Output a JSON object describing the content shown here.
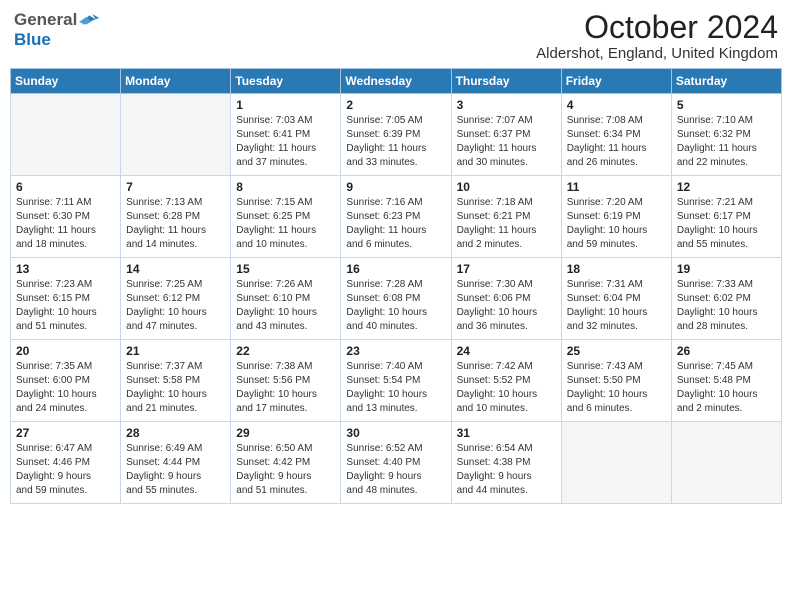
{
  "header": {
    "logo_general": "General",
    "logo_blue": "Blue",
    "month_title": "October 2024",
    "location": "Aldershot, England, United Kingdom"
  },
  "weekdays": [
    "Sunday",
    "Monday",
    "Tuesday",
    "Wednesday",
    "Thursday",
    "Friday",
    "Saturday"
  ],
  "weeks": [
    [
      {
        "day": "",
        "info": ""
      },
      {
        "day": "",
        "info": ""
      },
      {
        "day": "1",
        "info": "Sunrise: 7:03 AM\nSunset: 6:41 PM\nDaylight: 11 hours\nand 37 minutes."
      },
      {
        "day": "2",
        "info": "Sunrise: 7:05 AM\nSunset: 6:39 PM\nDaylight: 11 hours\nand 33 minutes."
      },
      {
        "day": "3",
        "info": "Sunrise: 7:07 AM\nSunset: 6:37 PM\nDaylight: 11 hours\nand 30 minutes."
      },
      {
        "day": "4",
        "info": "Sunrise: 7:08 AM\nSunset: 6:34 PM\nDaylight: 11 hours\nand 26 minutes."
      },
      {
        "day": "5",
        "info": "Sunrise: 7:10 AM\nSunset: 6:32 PM\nDaylight: 11 hours\nand 22 minutes."
      }
    ],
    [
      {
        "day": "6",
        "info": "Sunrise: 7:11 AM\nSunset: 6:30 PM\nDaylight: 11 hours\nand 18 minutes."
      },
      {
        "day": "7",
        "info": "Sunrise: 7:13 AM\nSunset: 6:28 PM\nDaylight: 11 hours\nand 14 minutes."
      },
      {
        "day": "8",
        "info": "Sunrise: 7:15 AM\nSunset: 6:25 PM\nDaylight: 11 hours\nand 10 minutes."
      },
      {
        "day": "9",
        "info": "Sunrise: 7:16 AM\nSunset: 6:23 PM\nDaylight: 11 hours\nand 6 minutes."
      },
      {
        "day": "10",
        "info": "Sunrise: 7:18 AM\nSunset: 6:21 PM\nDaylight: 11 hours\nand 2 minutes."
      },
      {
        "day": "11",
        "info": "Sunrise: 7:20 AM\nSunset: 6:19 PM\nDaylight: 10 hours\nand 59 minutes."
      },
      {
        "day": "12",
        "info": "Sunrise: 7:21 AM\nSunset: 6:17 PM\nDaylight: 10 hours\nand 55 minutes."
      }
    ],
    [
      {
        "day": "13",
        "info": "Sunrise: 7:23 AM\nSunset: 6:15 PM\nDaylight: 10 hours\nand 51 minutes."
      },
      {
        "day": "14",
        "info": "Sunrise: 7:25 AM\nSunset: 6:12 PM\nDaylight: 10 hours\nand 47 minutes."
      },
      {
        "day": "15",
        "info": "Sunrise: 7:26 AM\nSunset: 6:10 PM\nDaylight: 10 hours\nand 43 minutes."
      },
      {
        "day": "16",
        "info": "Sunrise: 7:28 AM\nSunset: 6:08 PM\nDaylight: 10 hours\nand 40 minutes."
      },
      {
        "day": "17",
        "info": "Sunrise: 7:30 AM\nSunset: 6:06 PM\nDaylight: 10 hours\nand 36 minutes."
      },
      {
        "day": "18",
        "info": "Sunrise: 7:31 AM\nSunset: 6:04 PM\nDaylight: 10 hours\nand 32 minutes."
      },
      {
        "day": "19",
        "info": "Sunrise: 7:33 AM\nSunset: 6:02 PM\nDaylight: 10 hours\nand 28 minutes."
      }
    ],
    [
      {
        "day": "20",
        "info": "Sunrise: 7:35 AM\nSunset: 6:00 PM\nDaylight: 10 hours\nand 24 minutes."
      },
      {
        "day": "21",
        "info": "Sunrise: 7:37 AM\nSunset: 5:58 PM\nDaylight: 10 hours\nand 21 minutes."
      },
      {
        "day": "22",
        "info": "Sunrise: 7:38 AM\nSunset: 5:56 PM\nDaylight: 10 hours\nand 17 minutes."
      },
      {
        "day": "23",
        "info": "Sunrise: 7:40 AM\nSunset: 5:54 PM\nDaylight: 10 hours\nand 13 minutes."
      },
      {
        "day": "24",
        "info": "Sunrise: 7:42 AM\nSunset: 5:52 PM\nDaylight: 10 hours\nand 10 minutes."
      },
      {
        "day": "25",
        "info": "Sunrise: 7:43 AM\nSunset: 5:50 PM\nDaylight: 10 hours\nand 6 minutes."
      },
      {
        "day": "26",
        "info": "Sunrise: 7:45 AM\nSunset: 5:48 PM\nDaylight: 10 hours\nand 2 minutes."
      }
    ],
    [
      {
        "day": "27",
        "info": "Sunrise: 6:47 AM\nSunset: 4:46 PM\nDaylight: 9 hours\nand 59 minutes."
      },
      {
        "day": "28",
        "info": "Sunrise: 6:49 AM\nSunset: 4:44 PM\nDaylight: 9 hours\nand 55 minutes."
      },
      {
        "day": "29",
        "info": "Sunrise: 6:50 AM\nSunset: 4:42 PM\nDaylight: 9 hours\nand 51 minutes."
      },
      {
        "day": "30",
        "info": "Sunrise: 6:52 AM\nSunset: 4:40 PM\nDaylight: 9 hours\nand 48 minutes."
      },
      {
        "day": "31",
        "info": "Sunrise: 6:54 AM\nSunset: 4:38 PM\nDaylight: 9 hours\nand 44 minutes."
      },
      {
        "day": "",
        "info": ""
      },
      {
        "day": "",
        "info": ""
      }
    ]
  ]
}
